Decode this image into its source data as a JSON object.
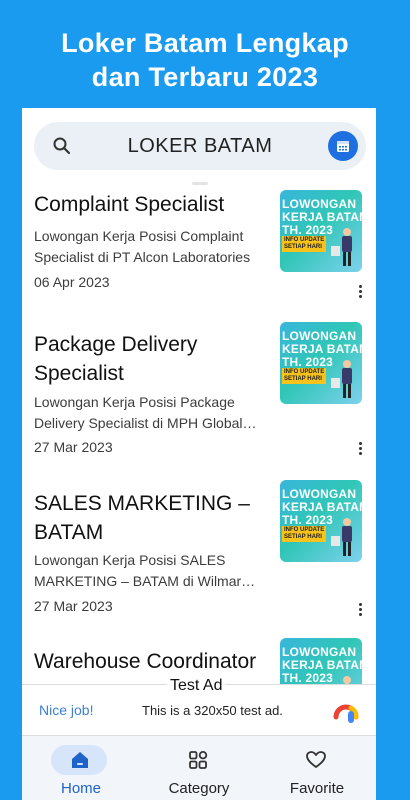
{
  "promo": {
    "title_line1": "Loker Batam Lengkap",
    "title_line2": "dan Terbaru 2023"
  },
  "search": {
    "text": "LOKER BATAM",
    "left_icon": "search-icon",
    "right_icon": "calendar-icon"
  },
  "items": [
    {
      "title": "Complaint Specialist",
      "description": "  Lowongan Kerja Posisi Complaint Specialist di PT Alcon Laboratories",
      "date": "06 Apr 2023",
      "thumb_text": "LOWONGAN\nKERJA BATAM\nTH. 2023",
      "thumb_tag": "INFO UPDATE\nSETIAP HARI"
    },
    {
      "title": "Package Delivery Specialist",
      "description": "Lowongan Kerja Posisi Package Delivery Specialist di MPH Global Logistics",
      "date": "27 Mar 2023",
      "thumb_text": "LOWONGAN\nKERJA BATAM\nTH. 2023",
      "thumb_tag": "INFO UPDATE\nSETIAP HARI"
    },
    {
      "title": "SALES MARKETING – BATAM",
      "description": "Lowongan Kerja Posisi SALES MARKETING – BATAM di Wilmar International",
      "date": "27 Mar 2023",
      "thumb_text": "LOWONGAN\nKERJA BATAM\nTH. 2023",
      "thumb_tag": "INFO UPDATE\nSETIAP HARI"
    },
    {
      "title": "Warehouse Coordinator",
      "description": "",
      "date": "",
      "thumb_text": "LOWONGAN\nKERJA BATAM\nTH. 2023",
      "thumb_tag": ""
    }
  ],
  "ad": {
    "label": "Test Ad",
    "nice": "Nice job!",
    "text": "This is a 320x50 test ad.",
    "icon": "admob-icon"
  },
  "nav": {
    "home": "Home",
    "category": "Category",
    "favorite": "Favorite",
    "active": "home",
    "accent": "#1e63c8"
  },
  "colors": {
    "background": "#1a9bf0",
    "thumb_primary": "#39b6dc",
    "tag": "#f7c21b"
  }
}
